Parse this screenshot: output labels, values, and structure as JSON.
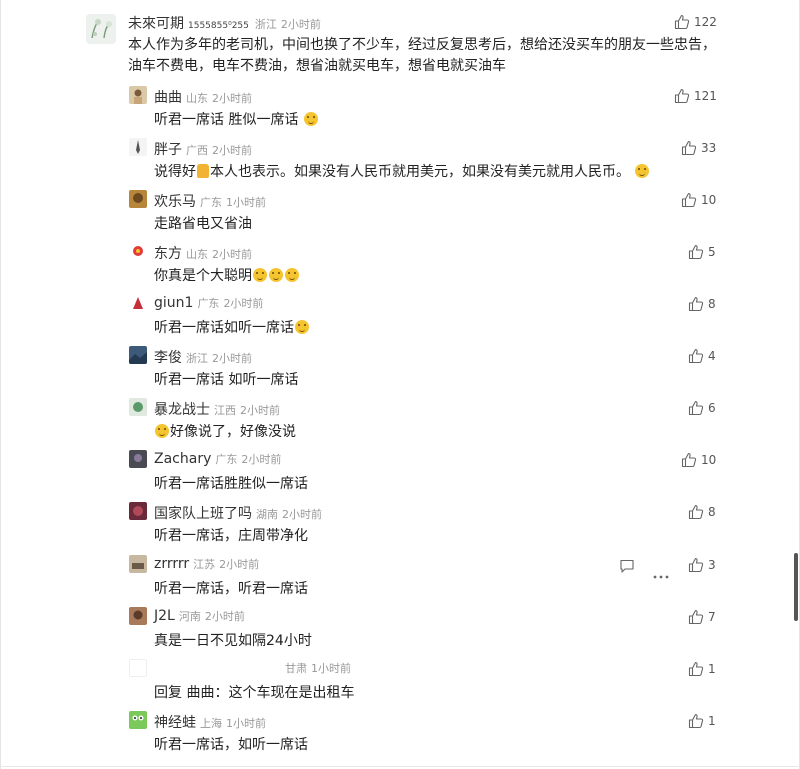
{
  "main_comment": {
    "user": "未來可期",
    "user_id": "1555855⁰255",
    "location": "浙江",
    "time": "2小时前",
    "text": "本人作为多年的老司机，中间也换了不少车，经过反复思考后，想给还没买车的朋友一些忠告，油车不费电，电车不费油，想省油就买电车，想省电就买油车",
    "likes": "122"
  },
  "replies": [
    {
      "user": "曲曲",
      "location": "山东",
      "time": "2小时前",
      "text": "听君一席话 胜似一席话",
      "emoji_after": "emoji",
      "likes": "121"
    },
    {
      "user": "胖子",
      "location": "广西",
      "time": "2小时前",
      "text_before": "说得好",
      "text_after": "本人也表示。如果没有人民币就用美元，如果没有美元就用人民币。",
      "likes": "33"
    },
    {
      "user": "欢乐马",
      "location": "广东",
      "time": "1小时前",
      "text": "走路省电又省油",
      "likes": "10"
    },
    {
      "user": "东方",
      "location": "山东",
      "time": "2小时前",
      "text": "你真是个大聪明",
      "likes": "5"
    },
    {
      "user": "giun1",
      "location": "广东",
      "time": "2小时前",
      "text": "听君一席话如听一席话",
      "likes": "8"
    },
    {
      "user": "李俊",
      "location": "浙江",
      "time": "2小时前",
      "text": "听君一席话 如听一席话",
      "likes": "4"
    },
    {
      "user": "暴龙战士",
      "location": "江西",
      "time": "2小时前",
      "text": "好像说了，好像没说",
      "likes": "6"
    },
    {
      "user": "Zachary",
      "location": "广东",
      "time": "2小时前",
      "text": "听君一席话胜胜似一席话",
      "likes": "10"
    },
    {
      "user": "国家队上班了吗",
      "location": "湖南",
      "time": "2小时前",
      "text": "听君一席话，庄周带净化",
      "likes": "8"
    },
    {
      "user": "zrrrrr",
      "location": "江苏",
      "time": "2小时前",
      "text": "听君一席话，听君一席话",
      "likes": "3"
    },
    {
      "user": "J2L",
      "location": "河南",
      "time": "2小时前",
      "text": "真是一日不见如隔24小时",
      "likes": "7"
    },
    {
      "user": "",
      "location": "甘肃",
      "time": "1小时前",
      "text": "回复 曲曲：这个车现在是出租车",
      "likes": "1"
    },
    {
      "user": "神经蛙",
      "location": "上海",
      "time": "1小时前",
      "text": "听君一席话，如听一席话",
      "likes": "1"
    }
  ],
  "icons": {
    "like": "thumbs-up-icon",
    "reply": "comment-icon",
    "more": "more-icon"
  },
  "colors": {
    "text": "#222222",
    "meta": "#999999",
    "icon": "#666666",
    "scrollbar": "#555555"
  }
}
